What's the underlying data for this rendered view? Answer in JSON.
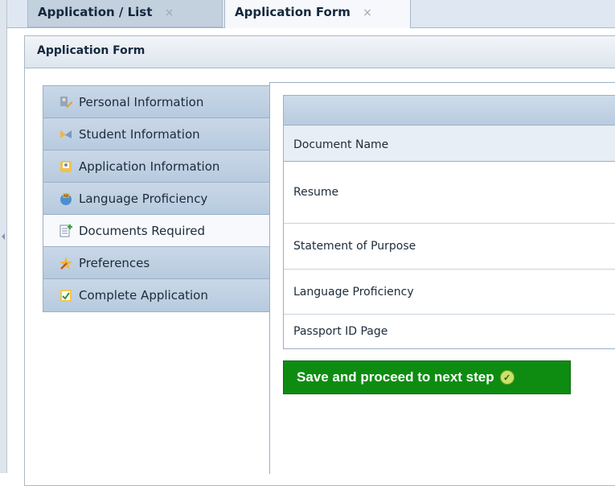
{
  "tabs": [
    {
      "label": "Application / List",
      "close": "×"
    },
    {
      "label": "Application Form",
      "close": "×"
    }
  ],
  "panel": {
    "title": "Application Form"
  },
  "steps": [
    {
      "label": "Personal Information",
      "icon": "person-edit-icon"
    },
    {
      "label": "Student Information",
      "icon": "student-icon"
    },
    {
      "label": "Application Information",
      "icon": "application-info-icon"
    },
    {
      "label": "Language Proficiency",
      "icon": "language-globe-icon"
    },
    {
      "label": "Documents Required",
      "icon": "document-add-icon",
      "active": true
    },
    {
      "label": "Preferences",
      "icon": "preferences-star-icon"
    },
    {
      "label": "Complete Application",
      "icon": "checklist-icon"
    }
  ],
  "documents": {
    "header": "Document Name",
    "rows": [
      "Resume",
      "Statement of Purpose",
      "Language Proficiency",
      "Passport ID Page"
    ]
  },
  "save_button": {
    "label": "Save and proceed to next step"
  },
  "colors": {
    "accent_green": "#0e8c12",
    "nav_blue": "#b7cade",
    "text": "#1c2b3b"
  }
}
